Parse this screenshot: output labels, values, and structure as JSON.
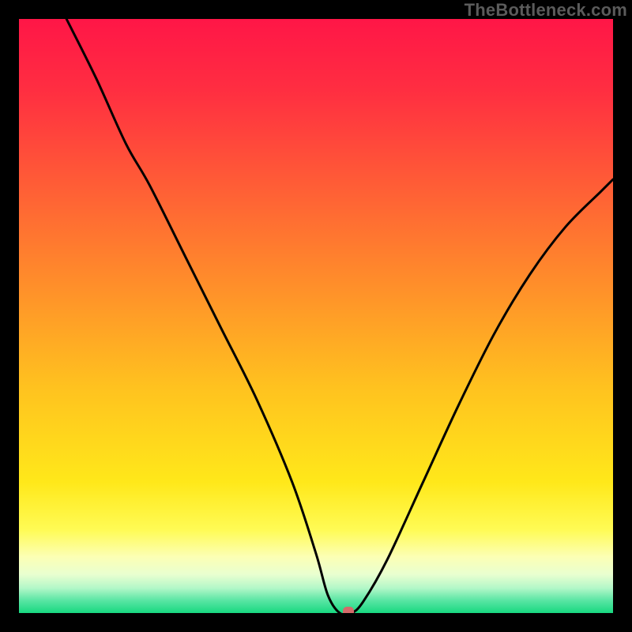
{
  "watermark": "TheBottleneck.com",
  "colors": {
    "gradient_stops": [
      {
        "offset": 0.0,
        "color": "#ff1647"
      },
      {
        "offset": 0.12,
        "color": "#ff2e41"
      },
      {
        "offset": 0.28,
        "color": "#ff5d36"
      },
      {
        "offset": 0.45,
        "color": "#ff8f2a"
      },
      {
        "offset": 0.62,
        "color": "#ffc21f"
      },
      {
        "offset": 0.78,
        "color": "#ffe81a"
      },
      {
        "offset": 0.86,
        "color": "#fffb55"
      },
      {
        "offset": 0.905,
        "color": "#fcffb4"
      },
      {
        "offset": 0.935,
        "color": "#e9ffd0"
      },
      {
        "offset": 0.958,
        "color": "#b3f7c8"
      },
      {
        "offset": 0.978,
        "color": "#5ce6a5"
      },
      {
        "offset": 1.0,
        "color": "#18d880"
      }
    ],
    "curve": "#000000",
    "marker": "#d46a6a",
    "black": "#000000"
  },
  "chart_data": {
    "type": "line",
    "title": "",
    "xlabel": "",
    "ylabel": "",
    "xlim": [
      0,
      100
    ],
    "ylim": [
      0,
      100
    ],
    "grid": false,
    "series": [
      {
        "name": "bottleneck-curve",
        "x": [
          8,
          13,
          18,
          22,
          28,
          34,
          40,
          46,
          50,
          52,
          54,
          56,
          58,
          62,
          68,
          74,
          80,
          86,
          92,
          98,
          100
        ],
        "y": [
          100,
          90,
          79,
          72,
          60,
          48,
          36,
          22,
          10,
          3,
          0,
          0,
          2,
          9,
          22,
          35,
          47,
          57,
          65,
          71,
          73
        ]
      }
    ],
    "marker": {
      "x": 55.5,
      "y": 0,
      "color": "#d46a6a"
    },
    "legend": false
  }
}
